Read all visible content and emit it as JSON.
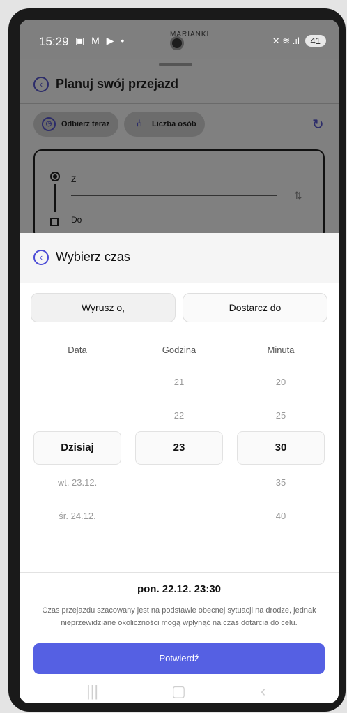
{
  "status": {
    "time": "15:29",
    "left_icons": "▣ M ▶ •",
    "carrier": "MARIANKI",
    "right_icons": "✕ ≋ .ıl",
    "battery": "41"
  },
  "background": {
    "title": "Planuj swój przejazd",
    "chip_now": "Odbierz teraz",
    "chip_people": "Liczba osób",
    "from_label": "Z",
    "to_label": "Do"
  },
  "sheet": {
    "title": "Wybierz czas",
    "toggle_depart": "Wyrusz o,",
    "toggle_arrive": "Dostarcz do",
    "columns": {
      "date": "Data",
      "hour": "Godzina",
      "minute": "Minuta"
    },
    "hours_above": [
      "21",
      "22"
    ],
    "minutes_above": [
      "20",
      "25"
    ],
    "selected": {
      "date": "Dzisiaj",
      "hour": "23",
      "minute": "30"
    },
    "dates_below": [
      "wt. 23.12.",
      "śr. 24.12."
    ],
    "minutes_below": [
      "35",
      "40"
    ],
    "summary": "pon. 22.12. 23:30",
    "note": "Czas przejazdu szacowany jest na podstawie obecnej sytuacji na drodze, jednak nieprzewidziane okoliczności mogą wpłynąć na czas dotarcia do celu.",
    "confirm": "Potwierdź"
  },
  "colors": {
    "accent": "#5560e3",
    "dim": "#808080"
  }
}
